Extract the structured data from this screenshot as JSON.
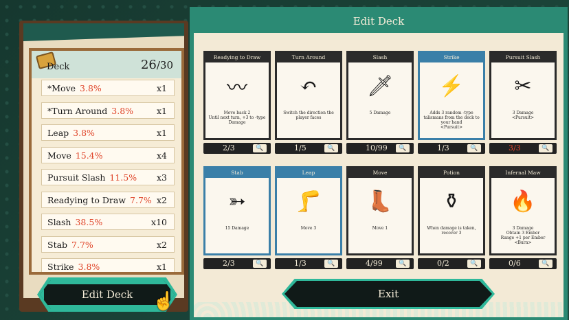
{
  "deck_panel": {
    "title": "Deck",
    "count": "26",
    "max": "/30",
    "items": [
      {
        "name": "*Move",
        "pct": "3.8%",
        "qty": "x1"
      },
      {
        "name": "*Turn Around",
        "pct": "3.8%",
        "qty": "x1"
      },
      {
        "name": "Leap",
        "pct": "3.8%",
        "qty": "x1"
      },
      {
        "name": "Move",
        "pct": "15.4%",
        "qty": "x4"
      },
      {
        "name": "Pursuit Slash",
        "pct": "11.5%",
        "qty": "x3"
      },
      {
        "name": "Readying to Draw",
        "pct": "7.7%",
        "qty": "x2"
      },
      {
        "name": "Slash",
        "pct": "38.5%",
        "qty": "x10"
      },
      {
        "name": "Stab",
        "pct": "7.7%",
        "qty": "x2"
      },
      {
        "name": "Strike",
        "pct": "3.8%",
        "qty": "x1"
      }
    ],
    "edit_button": "Edit Deck"
  },
  "edit_panel": {
    "title": "Edit Deck",
    "exit_button": "Exit",
    "cards": [
      {
        "title": "Readying to Draw",
        "desc": "Move back 2\nUntil next turn, +3 to -type Damage",
        "count": "2/3",
        "icon": "ink-swirl-icon",
        "blue": false,
        "red": false
      },
      {
        "title": "Turn Around",
        "desc": "Switch the direction the player faces",
        "count": "1/5",
        "icon": "turn-arrow-icon",
        "blue": false,
        "red": false
      },
      {
        "title": "Slash",
        "desc": "5 Damage",
        "count": "10/99",
        "icon": "sword-icon",
        "blue": false,
        "red": false
      },
      {
        "title": "Strike",
        "desc": "Adds 3 random -type talismans from the deck to your hand\n<Pursuit>",
        "count": "1/3",
        "icon": "strike-icon",
        "blue": true,
        "red": false
      },
      {
        "title": "Pursuit Slash",
        "desc": "3 Damage\n<Pursuit>",
        "count": "3/3",
        "icon": "pursuit-slash-icon",
        "blue": false,
        "red": true
      },
      {
        "title": "Stab",
        "desc": "15 Damage",
        "count": "2/3",
        "icon": "spear-icon",
        "blue": true,
        "red": false
      },
      {
        "title": "Leap",
        "desc": "Move 3",
        "count": "1/3",
        "icon": "leap-leg-icon",
        "blue": true,
        "red": false
      },
      {
        "title": "Move",
        "desc": "Move 1",
        "count": "4/99",
        "icon": "boot-icon",
        "blue": false,
        "red": false
      },
      {
        "title": "Potion",
        "desc": "When damage is taken, recover 3",
        "count": "0/2",
        "icon": "potion-icon",
        "blue": false,
        "red": false
      },
      {
        "title": "Infernal Maw",
        "desc": "3 Damage\nObtain 3 Ember\nRange +1 per Ember\n<Burn>",
        "count": "0/6",
        "icon": "fire-maw-icon",
        "blue": false,
        "red": false
      }
    ]
  }
}
